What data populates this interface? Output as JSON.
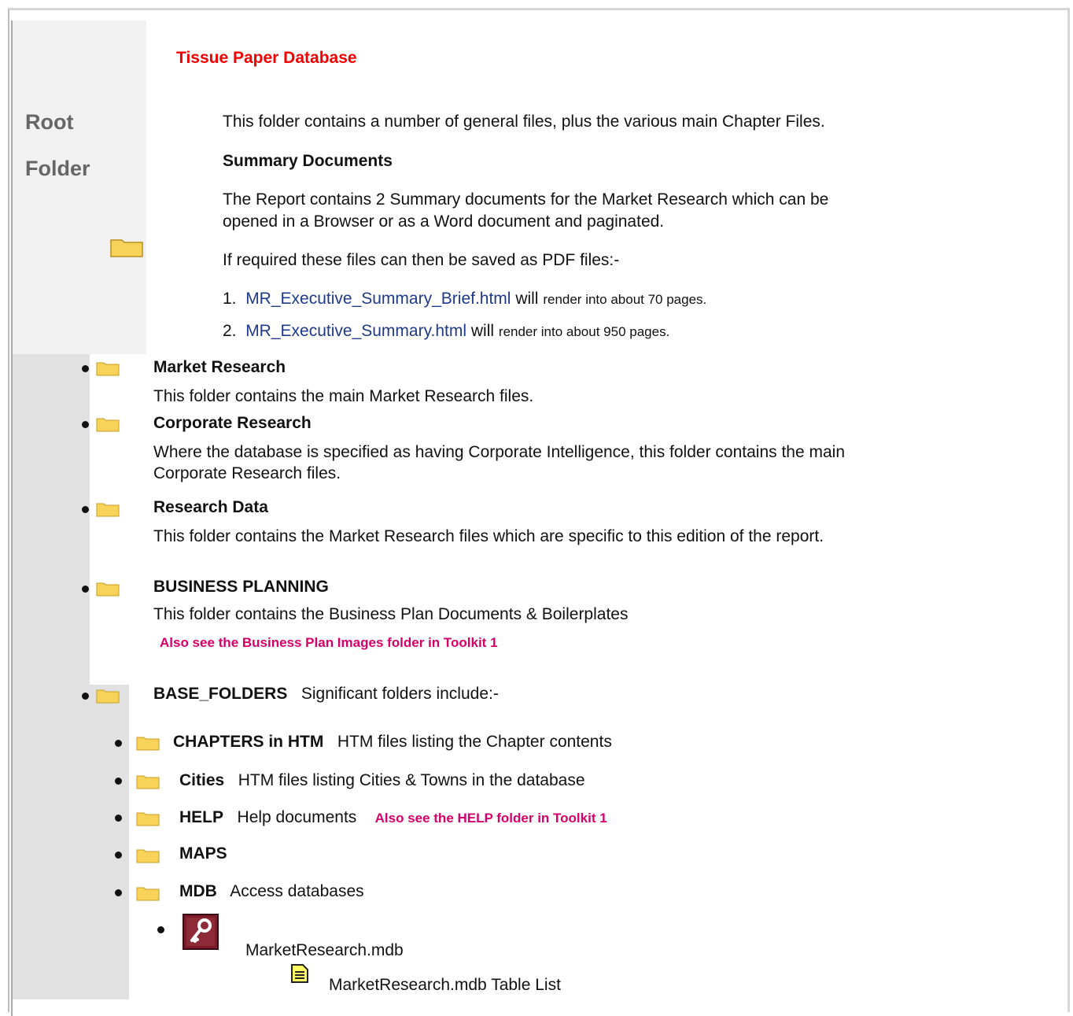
{
  "title": "Tissue Paper Database",
  "sidebar": {
    "line1": "Root",
    "line2": "Folder"
  },
  "intro": {
    "text": "This folder contains a number of general files, plus the various main Chapter Files.",
    "summary_heading": "Summary Documents",
    "summary_line1": "The Report contains 2 Summary documents for the Market Research which can be",
    "summary_line2": "opened in a Browser or as a Word document and paginated.",
    "pdf_note": "If required these files can then be saved as PDF files:-",
    "docs": [
      {
        "num": "1.",
        "link": "MR_Executive_Summary_Brief.html",
        "will": "will",
        "note": "render into about 70 pages."
      },
      {
        "num": "2.",
        "link": "MR_Executive_Summary.html",
        "will": "will",
        "note": "render into about 950 pages."
      }
    ]
  },
  "folders": [
    {
      "name": "Market Research",
      "desc": "This folder contains the main Market Research files."
    },
    {
      "name": "Corporate Research",
      "desc1": "Where the database is specified as having Corporate Intelligence, this folder contains the main",
      "desc2": "Corporate Research files."
    },
    {
      "name": "Research Data",
      "desc": "This folder contains the Market Research files which are specific to this edition of the report."
    },
    {
      "name": "BUSINESS PLANNING",
      "desc": "This folder contains the Business Plan Documents & Boilerplates",
      "note": "Also see the Business Plan Images folder in Toolkit 1"
    },
    {
      "name": "BASE_FOLDERS",
      "desc": "Significant folders include:-"
    }
  ],
  "subfolders": [
    {
      "name": "CHAPTERS in HTM",
      "desc": "HTM files listing the Chapter contents"
    },
    {
      "name": "Cities",
      "desc": "HTM files listing Cities & Towns in the database"
    },
    {
      "name": "HELP",
      "desc": "Help documents",
      "note": "Also see the HELP folder in Toolkit 1"
    },
    {
      "name": "MAPS",
      "desc": ""
    },
    {
      "name": "MDB",
      "desc": "Access databases"
    }
  ],
  "mdb": {
    "file": "MarketResearch.mdb",
    "table_list": "MarketResearch.mdb Table List"
  },
  "colors": {
    "title": "#f00000",
    "link": "#1f3a8a",
    "note": "#d6006b",
    "folder": "#f7d35a"
  }
}
